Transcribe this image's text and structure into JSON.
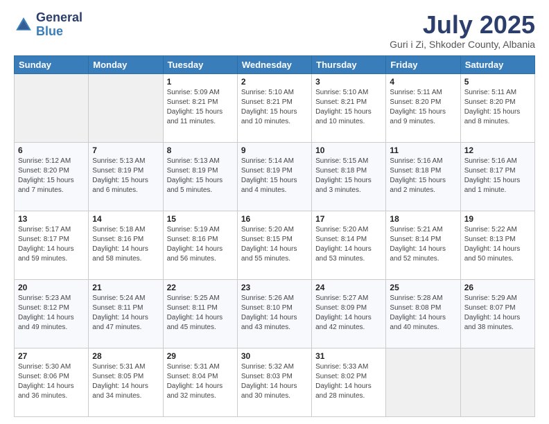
{
  "header": {
    "logo_general": "General",
    "logo_blue": "Blue",
    "month_title": "July 2025",
    "location": "Guri i Zi, Shkoder County, Albania"
  },
  "weekdays": [
    "Sunday",
    "Monday",
    "Tuesday",
    "Wednesday",
    "Thursday",
    "Friday",
    "Saturday"
  ],
  "weeks": [
    [
      {
        "day": "",
        "sunrise": "",
        "sunset": "",
        "daylight": ""
      },
      {
        "day": "",
        "sunrise": "",
        "sunset": "",
        "daylight": ""
      },
      {
        "day": "1",
        "sunrise": "Sunrise: 5:09 AM",
        "sunset": "Sunset: 8:21 PM",
        "daylight": "Daylight: 15 hours and 11 minutes."
      },
      {
        "day": "2",
        "sunrise": "Sunrise: 5:10 AM",
        "sunset": "Sunset: 8:21 PM",
        "daylight": "Daylight: 15 hours and 10 minutes."
      },
      {
        "day": "3",
        "sunrise": "Sunrise: 5:10 AM",
        "sunset": "Sunset: 8:21 PM",
        "daylight": "Daylight: 15 hours and 10 minutes."
      },
      {
        "day": "4",
        "sunrise": "Sunrise: 5:11 AM",
        "sunset": "Sunset: 8:20 PM",
        "daylight": "Daylight: 15 hours and 9 minutes."
      },
      {
        "day": "5",
        "sunrise": "Sunrise: 5:11 AM",
        "sunset": "Sunset: 8:20 PM",
        "daylight": "Daylight: 15 hours and 8 minutes."
      }
    ],
    [
      {
        "day": "6",
        "sunrise": "Sunrise: 5:12 AM",
        "sunset": "Sunset: 8:20 PM",
        "daylight": "Daylight: 15 hours and 7 minutes."
      },
      {
        "day": "7",
        "sunrise": "Sunrise: 5:13 AM",
        "sunset": "Sunset: 8:19 PM",
        "daylight": "Daylight: 15 hours and 6 minutes."
      },
      {
        "day": "8",
        "sunrise": "Sunrise: 5:13 AM",
        "sunset": "Sunset: 8:19 PM",
        "daylight": "Daylight: 15 hours and 5 minutes."
      },
      {
        "day": "9",
        "sunrise": "Sunrise: 5:14 AM",
        "sunset": "Sunset: 8:19 PM",
        "daylight": "Daylight: 15 hours and 4 minutes."
      },
      {
        "day": "10",
        "sunrise": "Sunrise: 5:15 AM",
        "sunset": "Sunset: 8:18 PM",
        "daylight": "Daylight: 15 hours and 3 minutes."
      },
      {
        "day": "11",
        "sunrise": "Sunrise: 5:16 AM",
        "sunset": "Sunset: 8:18 PM",
        "daylight": "Daylight: 15 hours and 2 minutes."
      },
      {
        "day": "12",
        "sunrise": "Sunrise: 5:16 AM",
        "sunset": "Sunset: 8:17 PM",
        "daylight": "Daylight: 15 hours and 1 minute."
      }
    ],
    [
      {
        "day": "13",
        "sunrise": "Sunrise: 5:17 AM",
        "sunset": "Sunset: 8:17 PM",
        "daylight": "Daylight: 14 hours and 59 minutes."
      },
      {
        "day": "14",
        "sunrise": "Sunrise: 5:18 AM",
        "sunset": "Sunset: 8:16 PM",
        "daylight": "Daylight: 14 hours and 58 minutes."
      },
      {
        "day": "15",
        "sunrise": "Sunrise: 5:19 AM",
        "sunset": "Sunset: 8:16 PM",
        "daylight": "Daylight: 14 hours and 56 minutes."
      },
      {
        "day": "16",
        "sunrise": "Sunrise: 5:20 AM",
        "sunset": "Sunset: 8:15 PM",
        "daylight": "Daylight: 14 hours and 55 minutes."
      },
      {
        "day": "17",
        "sunrise": "Sunrise: 5:20 AM",
        "sunset": "Sunset: 8:14 PM",
        "daylight": "Daylight: 14 hours and 53 minutes."
      },
      {
        "day": "18",
        "sunrise": "Sunrise: 5:21 AM",
        "sunset": "Sunset: 8:14 PM",
        "daylight": "Daylight: 14 hours and 52 minutes."
      },
      {
        "day": "19",
        "sunrise": "Sunrise: 5:22 AM",
        "sunset": "Sunset: 8:13 PM",
        "daylight": "Daylight: 14 hours and 50 minutes."
      }
    ],
    [
      {
        "day": "20",
        "sunrise": "Sunrise: 5:23 AM",
        "sunset": "Sunset: 8:12 PM",
        "daylight": "Daylight: 14 hours and 49 minutes."
      },
      {
        "day": "21",
        "sunrise": "Sunrise: 5:24 AM",
        "sunset": "Sunset: 8:11 PM",
        "daylight": "Daylight: 14 hours and 47 minutes."
      },
      {
        "day": "22",
        "sunrise": "Sunrise: 5:25 AM",
        "sunset": "Sunset: 8:11 PM",
        "daylight": "Daylight: 14 hours and 45 minutes."
      },
      {
        "day": "23",
        "sunrise": "Sunrise: 5:26 AM",
        "sunset": "Sunset: 8:10 PM",
        "daylight": "Daylight: 14 hours and 43 minutes."
      },
      {
        "day": "24",
        "sunrise": "Sunrise: 5:27 AM",
        "sunset": "Sunset: 8:09 PM",
        "daylight": "Daylight: 14 hours and 42 minutes."
      },
      {
        "day": "25",
        "sunrise": "Sunrise: 5:28 AM",
        "sunset": "Sunset: 8:08 PM",
        "daylight": "Daylight: 14 hours and 40 minutes."
      },
      {
        "day": "26",
        "sunrise": "Sunrise: 5:29 AM",
        "sunset": "Sunset: 8:07 PM",
        "daylight": "Daylight: 14 hours and 38 minutes."
      }
    ],
    [
      {
        "day": "27",
        "sunrise": "Sunrise: 5:30 AM",
        "sunset": "Sunset: 8:06 PM",
        "daylight": "Daylight: 14 hours and 36 minutes."
      },
      {
        "day": "28",
        "sunrise": "Sunrise: 5:31 AM",
        "sunset": "Sunset: 8:05 PM",
        "daylight": "Daylight: 14 hours and 34 minutes."
      },
      {
        "day": "29",
        "sunrise": "Sunrise: 5:31 AM",
        "sunset": "Sunset: 8:04 PM",
        "daylight": "Daylight: 14 hours and 32 minutes."
      },
      {
        "day": "30",
        "sunrise": "Sunrise: 5:32 AM",
        "sunset": "Sunset: 8:03 PM",
        "daylight": "Daylight: 14 hours and 30 minutes."
      },
      {
        "day": "31",
        "sunrise": "Sunrise: 5:33 AM",
        "sunset": "Sunset: 8:02 PM",
        "daylight": "Daylight: 14 hours and 28 minutes."
      },
      {
        "day": "",
        "sunrise": "",
        "sunset": "",
        "daylight": ""
      },
      {
        "day": "",
        "sunrise": "",
        "sunset": "",
        "daylight": ""
      }
    ]
  ]
}
